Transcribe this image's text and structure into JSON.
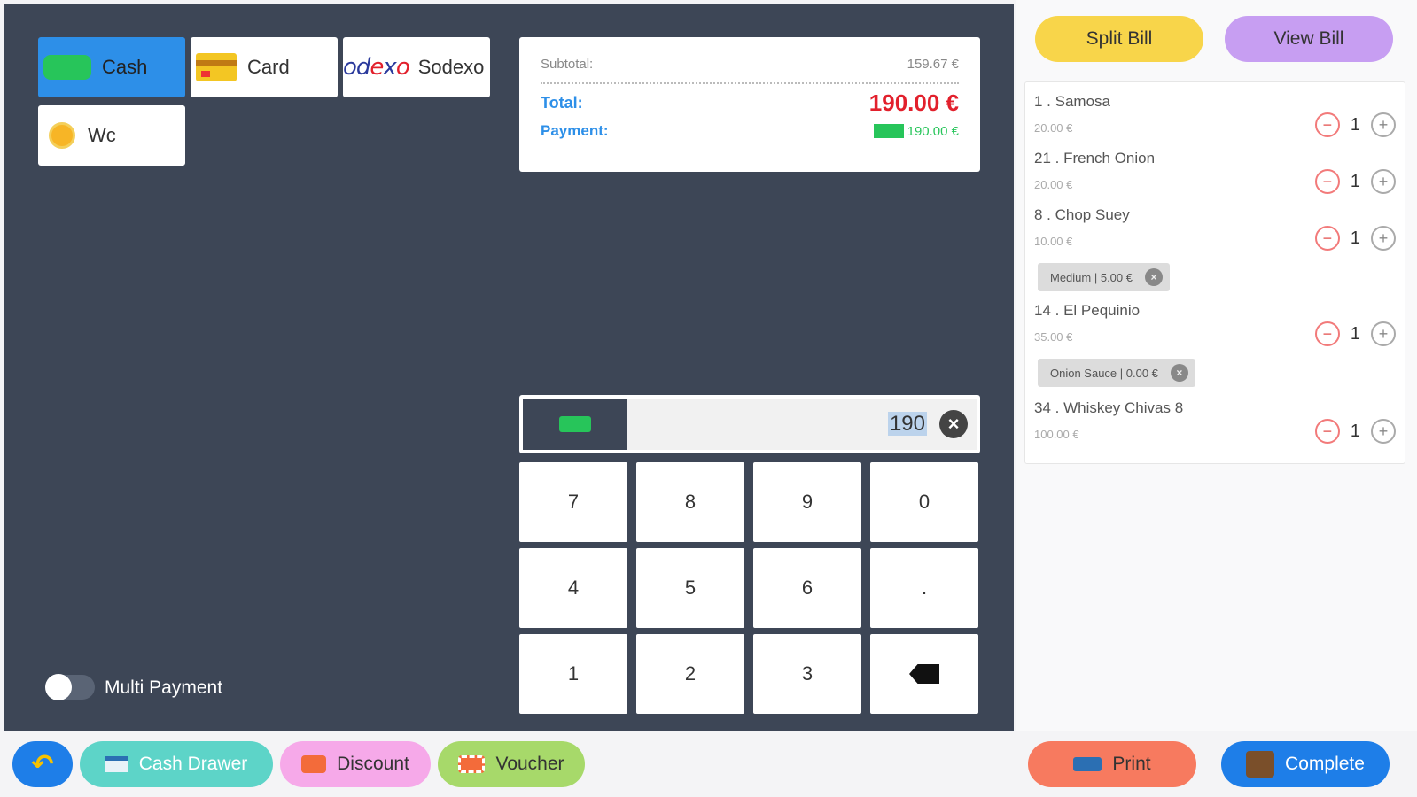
{
  "payment_methods": [
    {
      "label": "Cash",
      "icon": "cash-icon",
      "active": true
    },
    {
      "label": "Card",
      "icon": "card-icon",
      "active": false
    },
    {
      "label": "Sodexo",
      "icon": "sodexo-logo",
      "active": false
    },
    {
      "label": "Wc",
      "icon": "coin-icon",
      "active": false
    }
  ],
  "sodexo_logo_text": {
    "a": "od",
    "b": "e",
    "c": "x",
    "d": "o"
  },
  "summary": {
    "subtotal_label": "Subtotal:",
    "subtotal_value": "159.67 €",
    "total_label": "Total:",
    "total_value": "190.00 €",
    "payment_label": "Payment:",
    "payment_value": "190.00 €"
  },
  "entry": {
    "value": "190",
    "clear_glyph": "×"
  },
  "keypad": [
    "7",
    "8",
    "9",
    "0",
    "4",
    "5",
    "6",
    ".",
    "1",
    "2",
    "3",
    "backspace"
  ],
  "multi_payment": {
    "label": "Multi Payment",
    "enabled": false
  },
  "right": {
    "split_bill": "Split Bill",
    "view_bill": "View Bill",
    "items": [
      {
        "name": "1 . Samosa",
        "price": "20.00 €",
        "qty": "1"
      },
      {
        "name": "21 . French Onion",
        "price": "20.00 €",
        "qty": "1"
      },
      {
        "name": "8 . Chop Suey",
        "price": "10.00 €",
        "qty": "1",
        "modifier": "Medium | 5.00 €"
      },
      {
        "name": "14 . El Pequinio",
        "price": "35.00 €",
        "qty": "1",
        "modifier": "Onion Sauce | 0.00 €"
      },
      {
        "name": "34 . Whiskey Chivas 8",
        "price": "100.00 €",
        "qty": "1"
      }
    ],
    "minus_glyph": "−",
    "plus_glyph": "+",
    "mod_remove_glyph": "×"
  },
  "bottom": {
    "back_glyph": "↶",
    "cash_drawer": "Cash Drawer",
    "discount": "Discount",
    "voucher": "Voucher",
    "print": "Print",
    "complete": "Complete"
  },
  "colors": {
    "panel_bg": "#3d4656",
    "active_blue": "#2d8fe8",
    "total_red": "#e2202c",
    "cash_green": "#27c55a"
  }
}
